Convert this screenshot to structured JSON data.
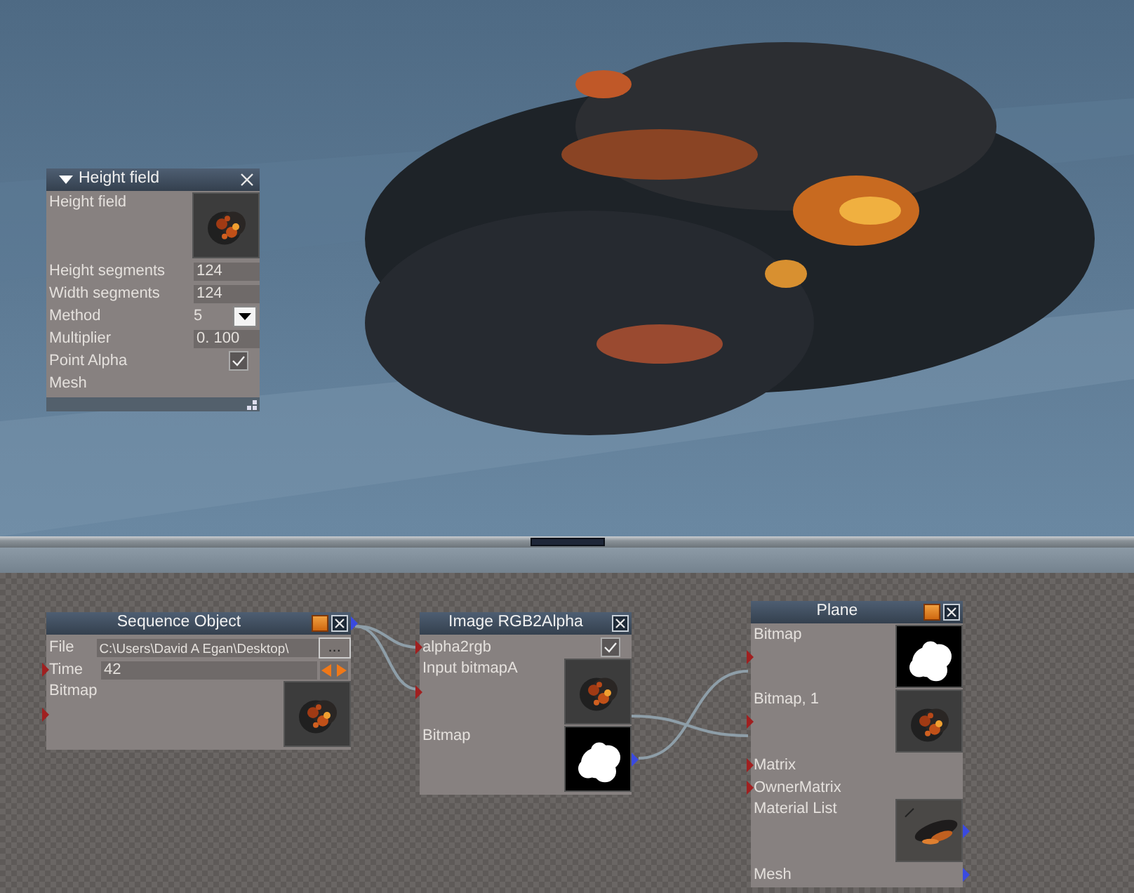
{
  "height_field_panel": {
    "title": "Height field",
    "expanded": true,
    "rows": [
      {
        "label": "Height field"
      },
      {
        "kind": "value",
        "label": "Height segments",
        "value": "124"
      },
      {
        "kind": "value",
        "label": "Width segments",
        "value": "124"
      },
      {
        "kind": "dropdown",
        "label": "Method",
        "value": "5"
      },
      {
        "kind": "value",
        "label": "Multiplier",
        "value": "0. 100"
      },
      {
        "kind": "checkbox",
        "label": "Point Alpha",
        "checked": true
      },
      {
        "kind": "label",
        "label": "Mesh"
      }
    ]
  },
  "nodes": [
    {
      "title": "Sequence Object",
      "color_button": true,
      "title_output": true,
      "rows": [
        {
          "kind": "file",
          "label": "File",
          "value": "C:\\Users\\David A Egan\\Desktop\\",
          "button": "...",
          "input": false,
          "output": false
        },
        {
          "kind": "spinner",
          "label": "Time",
          "value": "42",
          "input": true,
          "output": false
        },
        {
          "label": "Bitmap",
          "input": true,
          "output": false
        }
      ]
    },
    {
      "title": "Image RGB2Alpha",
      "color_button": false,
      "title_output": false,
      "rows": [
        {
          "kind": "checkbox",
          "label": "alpha2rgb",
          "checked": true,
          "input": true,
          "output": false
        },
        {
          "label": "Input bitmapA",
          "input": true,
          "output": false
        },
        {
          "label": "Bitmap",
          "input": false,
          "output": true
        }
      ]
    },
    {
      "title": "Plane",
      "color_button": true,
      "title_output": false,
      "rows": [
        {
          "label": "Bitmap",
          "input": true,
          "output": false
        },
        {
          "label": "Bitmap, 1",
          "input": true,
          "output": false
        },
        {
          "kind": "label",
          "label": "Matrix",
          "input": true,
          "output": false
        },
        {
          "kind": "label",
          "label": "OwnerMatrix",
          "input": true,
          "output": false
        },
        {
          "label": "Material List",
          "input": false,
          "output": true
        },
        {
          "kind": "label",
          "label": "Mesh",
          "input": false,
          "output": true
        }
      ]
    }
  ]
}
